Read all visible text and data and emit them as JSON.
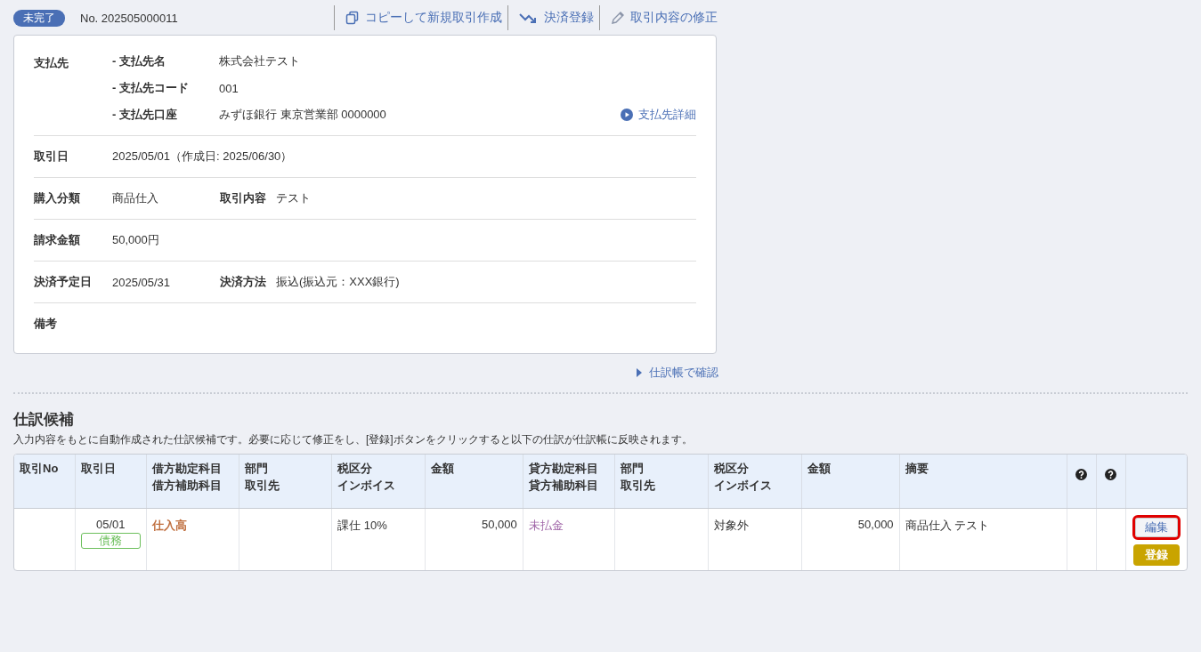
{
  "header": {
    "status_badge": "未完了",
    "number": "No. 202505000011",
    "actions": [
      {
        "label": "コピーして新規取引作成"
      },
      {
        "label": "決済登録"
      },
      {
        "label": "取引内容の修正"
      }
    ]
  },
  "details": {
    "payee": {
      "label": "支払先",
      "fields": [
        {
          "label": "- 支払先名",
          "value": "株式会社テスト"
        },
        {
          "label": "- 支払先コード",
          "value": "001"
        },
        {
          "label": "- 支払先口座",
          "value": "みずほ銀行 東京営業部 0000000"
        }
      ],
      "link": "支払先詳細"
    },
    "rows": [
      {
        "items": [
          {
            "label": "取引日",
            "value": "2025/05/01（作成日: 2025/06/30）"
          }
        ]
      },
      {
        "items": [
          {
            "label": "購入分類",
            "value": "商品仕入"
          },
          {
            "label": "取引内容",
            "value": "テスト"
          }
        ]
      },
      {
        "items": [
          {
            "label": "請求金額",
            "value": "50,000円"
          }
        ]
      },
      {
        "items": [
          {
            "label": "決済予定日",
            "value": "2025/05/31"
          },
          {
            "label": "決済方法",
            "value": "振込(振込元：XXX銀行)"
          }
        ]
      },
      {
        "items": [
          {
            "label": "備考"
          }
        ]
      }
    ]
  },
  "journal_link": "仕訳帳で確認",
  "candidates": {
    "title": "仕訳候補",
    "description": "入力内容をもとに自動作成された仕訳候補です。必要に応じて修正をし、[登録]ボタンをクリックすると以下の仕訳が仕訳帳に反映されます。",
    "columns": [
      {
        "kind": "text",
        "lines": [
          "取引No"
        ]
      },
      {
        "kind": "text",
        "lines": [
          "取引日"
        ]
      },
      {
        "kind": "text",
        "lines": [
          "借方勘定科目",
          "借方補助科目"
        ]
      },
      {
        "kind": "text",
        "lines": [
          "部門",
          "取引先"
        ]
      },
      {
        "kind": "text",
        "lines": [
          "税区分",
          "インボイス"
        ]
      },
      {
        "kind": "text",
        "lines": [
          "金額"
        ]
      },
      {
        "kind": "text",
        "lines": [
          "貸方勘定科目",
          "貸方補助科目"
        ]
      },
      {
        "kind": "text",
        "lines": [
          "部門",
          "取引先"
        ]
      },
      {
        "kind": "text",
        "lines": [
          "税区分",
          "インボイス"
        ]
      },
      {
        "kind": "text",
        "lines": [
          "金額"
        ]
      },
      {
        "kind": "text",
        "lines": [
          "摘要"
        ]
      },
      {
        "kind": "help"
      },
      {
        "kind": "help"
      },
      {
        "kind": "blank"
      }
    ],
    "rows": [
      {
        "cells": [
          {
            "kind": "empty"
          },
          {
            "kind": "date",
            "value": "05/01",
            "tag": "債務"
          },
          {
            "kind": "debit",
            "value": "仕入高"
          },
          {
            "kind": "empty"
          },
          {
            "kind": "text",
            "value": "課仕 10%"
          },
          {
            "kind": "amount",
            "value": "50,000"
          },
          {
            "kind": "credit",
            "value": "未払金"
          },
          {
            "kind": "empty"
          },
          {
            "kind": "text",
            "value": "対象外"
          },
          {
            "kind": "amount",
            "value": "50,000"
          },
          {
            "kind": "text",
            "value": "商品仕入 テスト"
          },
          {
            "kind": "empty"
          },
          {
            "kind": "empty"
          },
          {
            "kind": "actions",
            "edit": "編集",
            "edit_highlighted": true,
            "register": "登録"
          }
        ]
      }
    ]
  }
}
